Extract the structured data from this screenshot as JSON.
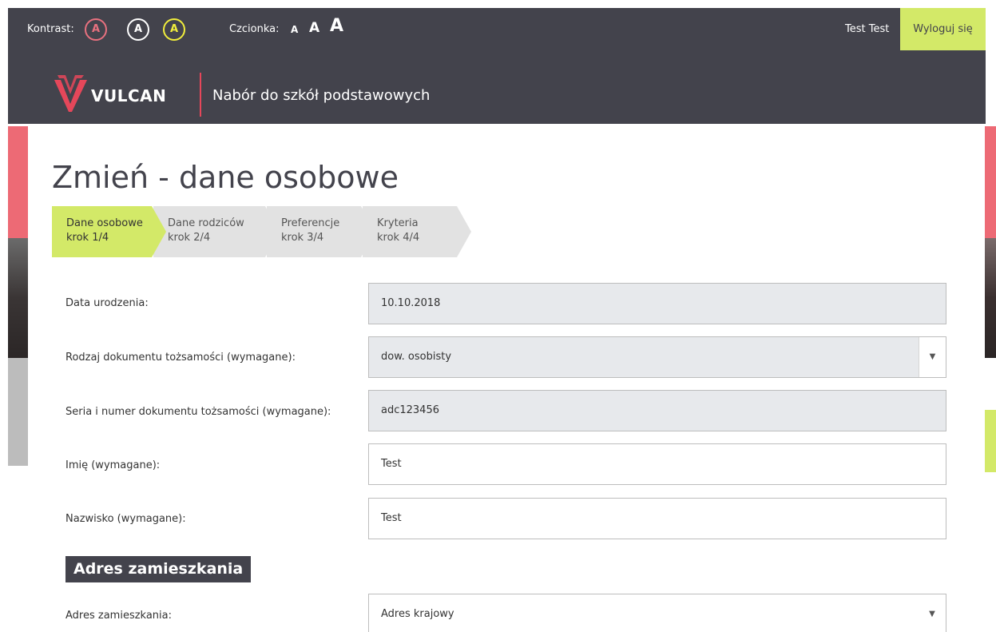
{
  "accessibility": {
    "contrast_label": "Kontrast:",
    "contrast_options": [
      "A",
      "A",
      "A"
    ],
    "font_label": "Czcionka:",
    "font_options": [
      "A",
      "A",
      "A"
    ]
  },
  "user": {
    "name": "Test Test",
    "logout_label": "Wyloguj się"
  },
  "brand": {
    "logo_text": "VULCAN",
    "app_title": "Nabór do szkół podstawowych"
  },
  "page": {
    "title": "Zmień - dane osobowe"
  },
  "steps": [
    {
      "name": "Dane osobowe",
      "step": "krok 1/4",
      "active": true
    },
    {
      "name": "Dane rodziców",
      "step": "krok 2/4",
      "active": false
    },
    {
      "name": "Preferencje",
      "step": "krok 3/4",
      "active": false
    },
    {
      "name": "Kryteria",
      "step": "krok 4/4",
      "active": false
    }
  ],
  "form": {
    "birth_date": {
      "label": "Data urodzenia:",
      "value": "10.10.2018"
    },
    "doc_type": {
      "label": "Rodzaj dokumentu tożsamości (wymagane):",
      "value": "dow. osobisty"
    },
    "doc_number": {
      "label": "Seria i numer dokumentu tożsamości (wymagane):",
      "value": "adc123456"
    },
    "first_name": {
      "label": "Imię (wymagane):",
      "value": "Test"
    },
    "last_name": {
      "label": "Nazwisko (wymagane):",
      "value": "Test"
    }
  },
  "address_section": {
    "header": "Adres zamieszkania",
    "type": {
      "label": "Adres zamieszkania:",
      "value": "Adres krajowy"
    }
  },
  "colors": {
    "topbar": "#43434c",
    "accent_lime": "#d3e968",
    "accent_red": "#e5475a",
    "readonly_field": "#e7e9ec"
  },
  "icons": {
    "select_arrow": "caret-down-icon"
  }
}
